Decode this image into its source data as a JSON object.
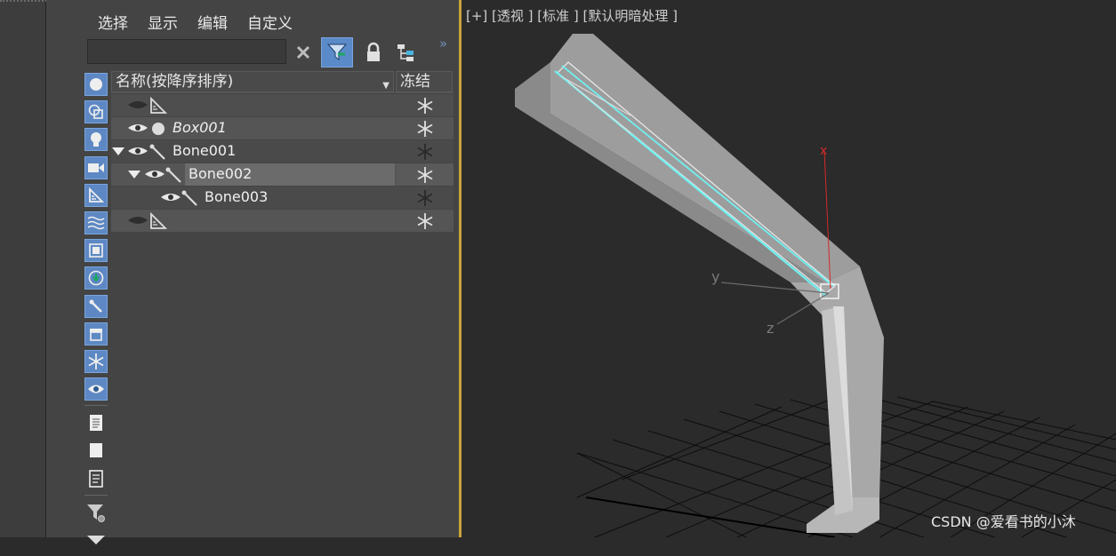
{
  "menu": [
    "选择",
    "显示",
    "编辑",
    "自定义"
  ],
  "search": {
    "value": "",
    "placeholder": ""
  },
  "table": {
    "col_name": "名称(按降序排序)",
    "col_freeze": "冻结",
    "rows": [
      {
        "label": "",
        "italic": false,
        "selected": false
      },
      {
        "label": "Box001",
        "italic": true,
        "selected": false
      },
      {
        "label": "Bone001",
        "italic": false,
        "selected": false
      },
      {
        "label": "Bone002",
        "italic": false,
        "selected": true
      },
      {
        "label": "Bone003",
        "italic": false,
        "selected": false
      },
      {
        "label": "",
        "italic": false,
        "selected": false
      }
    ]
  },
  "viewport": {
    "label": "[+] [透视 ] [标准 ] [默认明暗处理 ]",
    "axis_x": "x",
    "axis_y": "y",
    "axis_z": "z"
  },
  "watermark": "CSDN @爱看书的小沐",
  "colors": {
    "accent": "#5d88c3",
    "selected_row": "#6b6b6b",
    "viewport_border": "#c9a43a",
    "bone_highlight": "#6ff0f0",
    "x_axis": "#d42a2a"
  }
}
